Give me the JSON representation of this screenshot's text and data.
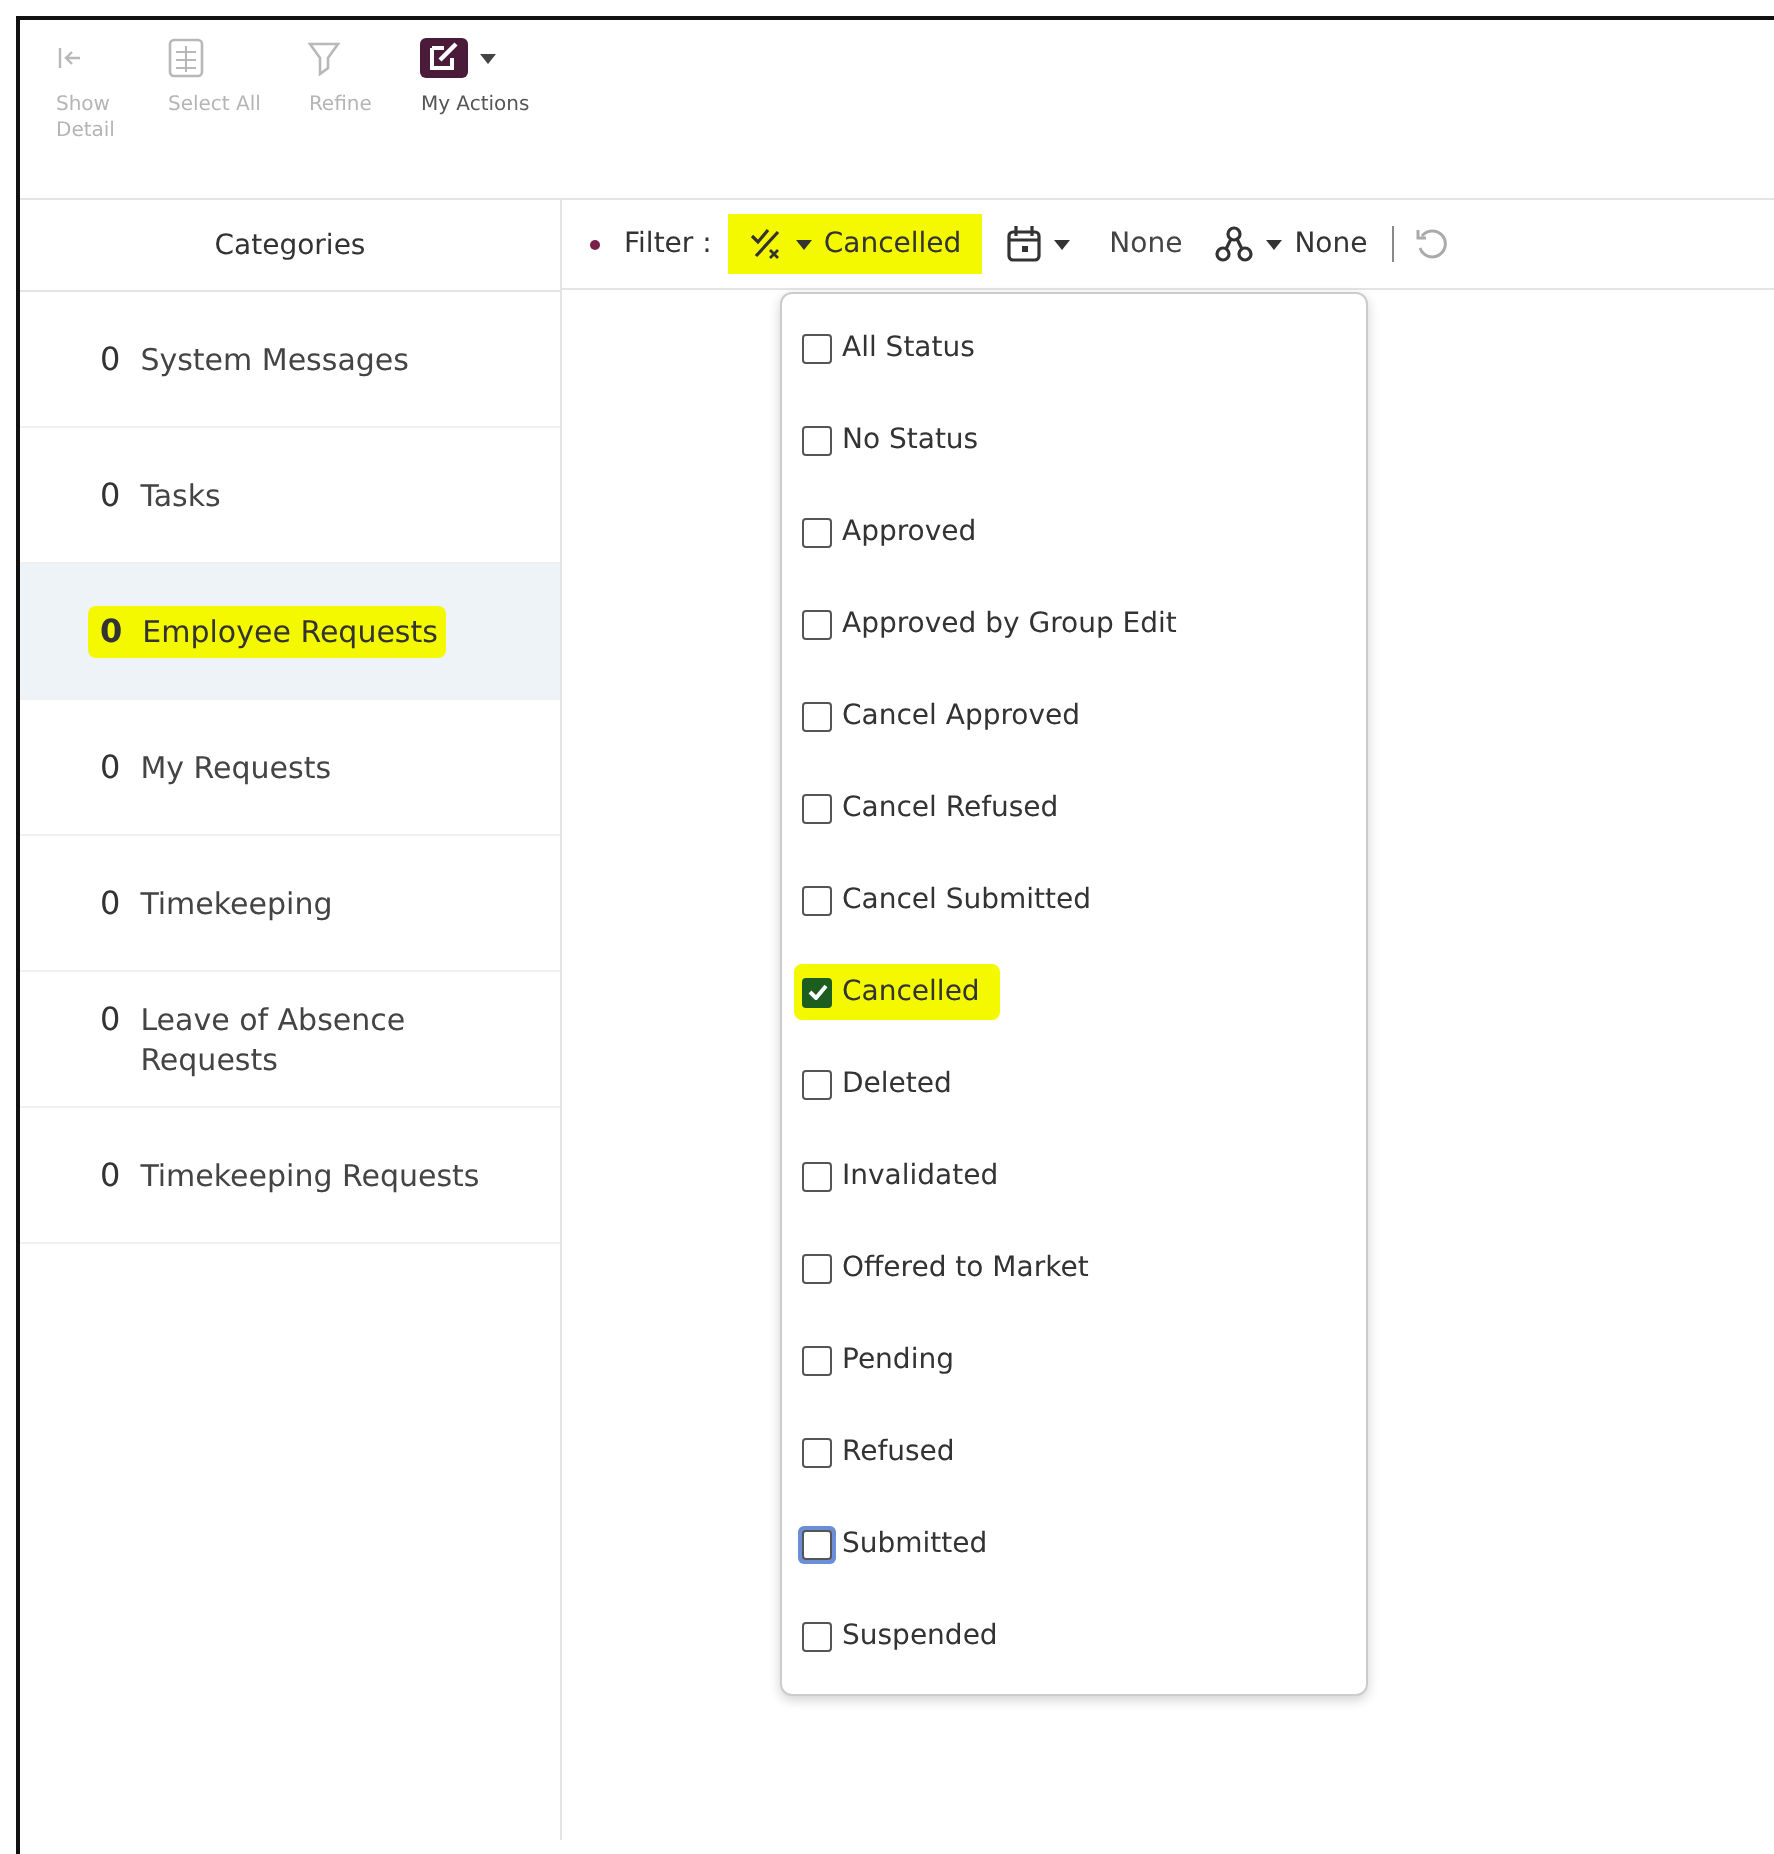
{
  "toolbar": [
    {
      "kind": "show-detail",
      "label": "Show\nDetail",
      "disabled": true
    },
    {
      "kind": "select-all",
      "label": "Select All",
      "disabled": true
    },
    {
      "kind": "refine",
      "label": "Refine",
      "disabled": true
    },
    {
      "kind": "actions",
      "label": "My Actions",
      "disabled": false
    }
  ],
  "categories": {
    "title": "Categories",
    "items": [
      {
        "count": "0",
        "label": "System Messages",
        "selected": false,
        "highlighted": false
      },
      {
        "count": "0",
        "label": "Tasks",
        "selected": false,
        "highlighted": false
      },
      {
        "count": "0",
        "label": "Employee Requests",
        "selected": true,
        "highlighted": true
      },
      {
        "count": "0",
        "label": "My Requests",
        "selected": false,
        "highlighted": false
      },
      {
        "count": "0",
        "label": "Timekeeping",
        "selected": false,
        "highlighted": false
      },
      {
        "count": "0",
        "label": "Leave of Absence Requests",
        "selected": false,
        "highlighted": false
      },
      {
        "count": "0",
        "label": "Timekeeping Requests",
        "selected": false,
        "highlighted": false
      }
    ]
  },
  "filter": {
    "label": "Filter :",
    "status": {
      "value": "Cancelled",
      "highlighted": true
    },
    "date": {
      "value": "None"
    },
    "group": {
      "value": "None"
    }
  },
  "status_menu": [
    {
      "label": "All Status",
      "checked": false,
      "focused": false,
      "highlighted": false
    },
    {
      "label": "No Status",
      "checked": false,
      "focused": false,
      "highlighted": false
    },
    {
      "label": "Approved",
      "checked": false,
      "focused": false,
      "highlighted": false
    },
    {
      "label": "Approved by Group Edit",
      "checked": false,
      "focused": false,
      "highlighted": false
    },
    {
      "label": "Cancel Approved",
      "checked": false,
      "focused": false,
      "highlighted": false
    },
    {
      "label": "Cancel Refused",
      "checked": false,
      "focused": false,
      "highlighted": false
    },
    {
      "label": "Cancel Submitted",
      "checked": false,
      "focused": false,
      "highlighted": false
    },
    {
      "label": "Cancelled",
      "checked": true,
      "focused": false,
      "highlighted": true
    },
    {
      "label": "Deleted",
      "checked": false,
      "focused": false,
      "highlighted": false
    },
    {
      "label": "Invalidated",
      "checked": false,
      "focused": false,
      "highlighted": false
    },
    {
      "label": "Offered to Market",
      "checked": false,
      "focused": false,
      "highlighted": false
    },
    {
      "label": "Pending",
      "checked": false,
      "focused": false,
      "highlighted": false
    },
    {
      "label": "Refused",
      "checked": false,
      "focused": false,
      "highlighted": false
    },
    {
      "label": "Submitted",
      "checked": false,
      "focused": true,
      "highlighted": false
    },
    {
      "label": "Suspended",
      "checked": false,
      "focused": false,
      "highlighted": false
    }
  ]
}
